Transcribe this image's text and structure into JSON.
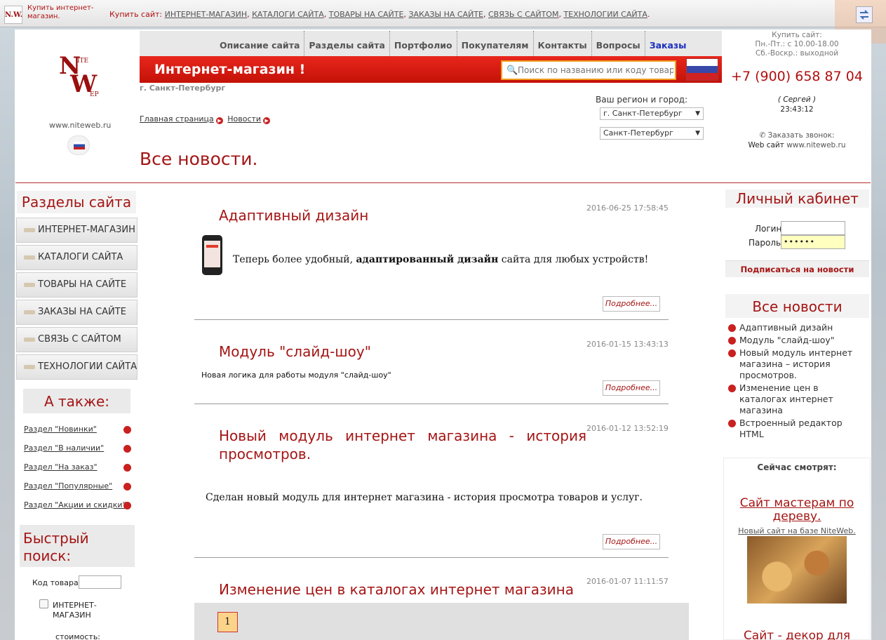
{
  "topbar": {
    "logo_text": "N.W.",
    "mini_text": "Купить интернет-магазин.",
    "buy_label": "Купить сайт:",
    "links": [
      "ИНТЕРНЕТ-МАГАЗИН",
      "КАТАЛОГИ САЙТА",
      "ТОВАРЫ НА САЙТЕ",
      "ЗАКАЗЫ НА САЙТЕ",
      "СВЯЗЬ С САЙТОМ",
      "ТЕХНОЛОГИИ САЙТА"
    ]
  },
  "brand": {
    "n": "N",
    "w": "W",
    "ite": "ITE",
    "ep": "EP",
    "url": "www.niteweb.ru"
  },
  "nav": {
    "items": [
      "Описание сайта",
      "Разделы сайта",
      "Портфолио",
      "Покупателям",
      "Контакты",
      "Вопросы",
      "Заказы"
    ]
  },
  "header": {
    "shop_title": "Интернет-магазин !",
    "search_placeholder": "Поиск по названию или коду товара",
    "city": "г. Санкт-Петербург",
    "region_label": "Ваш регион и город:",
    "region_value": "г. Санкт-Петербург",
    "city_value": "Санкт-Петербург"
  },
  "breadcrumb": {
    "home": "Главная страница",
    "current": "Новости"
  },
  "page_title": "Все новости.",
  "contact": {
    "buy": "Купить сайт:",
    "hours": "Пн.-Пт.: с 10.00-18.00",
    "weekend": "Сб.-Воскр.: выходной",
    "phone": "+7 (900) 658 87 04",
    "person": "( Сергей )",
    "time": "23:43:12",
    "callback": "Заказать звонок:",
    "web_label": "Web сайт",
    "web_url": "www.niteweb.ru"
  },
  "sidebar": {
    "title": "Разделы сайта",
    "items": [
      "ИНТЕРНЕТ-МАГАЗИН",
      "КАТАЛОГИ САЙТА",
      "ТОВАРЫ НА САЙТЕ",
      "ЗАКАЗЫ НА САЙТЕ",
      "СВЯЗЬ С САЙТОМ",
      "ТЕХНОЛОГИИ САЙТА"
    ],
    "also_title": "А также:",
    "also_items": [
      "Раздел \"Новинки\"",
      "Раздел \"В наличии\"",
      "Раздел \"На заказ\"",
      "Раздел \"Популярные\"",
      "Раздел \"Акции и скидки\""
    ],
    "quick_search_title": "Быстрый поиск:",
    "product_code_label": "Код товара:",
    "checkbox_label": "ИНТЕРНЕТ-МАГАЗИН",
    "cost_label": "стоимость:"
  },
  "posts": [
    {
      "title": "Адаптивный дизайн",
      "date": "2016-06-25 17:58:45",
      "text_before": "Теперь более удобный,",
      "text_bold": "адаптированный дизайн",
      "text_after": "сайта для любых устройств!",
      "more": "Подробнее..."
    },
    {
      "title": "Модуль \"слайд-шоу\"",
      "date": "2016-01-15 13:43:13",
      "text": "Новая логика для работы модуля \"слайд-шоу\"",
      "more": "Подробнее..."
    },
    {
      "title_line1": "Новый модуль интернет магазина - история",
      "title_line2": "просмотров.",
      "date": "2016-01-12 13:52:19",
      "text": "Сделан новый модуль для интернет магазина - история просмотра товаров и услуг.",
      "more": "Подробнее..."
    },
    {
      "title": "Изменение цен в каталогах интернет магазина",
      "date": "2016-01-07 11:11:57"
    }
  ],
  "pager": {
    "current": "1"
  },
  "account": {
    "title": "Личный кабинет",
    "login_label": "Логин:",
    "password_label": "Пароль:",
    "password_value": "••••••",
    "subscribe": "Подписаться на новости"
  },
  "news_box": {
    "title": "Все новости",
    "items": [
      "Адаптивный дизайн",
      "Модуль \"слайд-шоу\"",
      "Новый модуль интернет магазина – история просмотров.",
      "Изменение цен в каталогах интернет магазина",
      "Встроенный редактор HTML"
    ]
  },
  "watching": {
    "label": "Сейчас смотрят:",
    "promo1_title": "Сайт мастерам по дереву.",
    "promo1_sub": "Новый сайт на базе NiteWeb.",
    "promo2_title": "Сайт - декор для"
  },
  "colors": {
    "accent": "#a51515",
    "red_bar": "#d81a10",
    "nav_active": "#1a2fbf"
  }
}
